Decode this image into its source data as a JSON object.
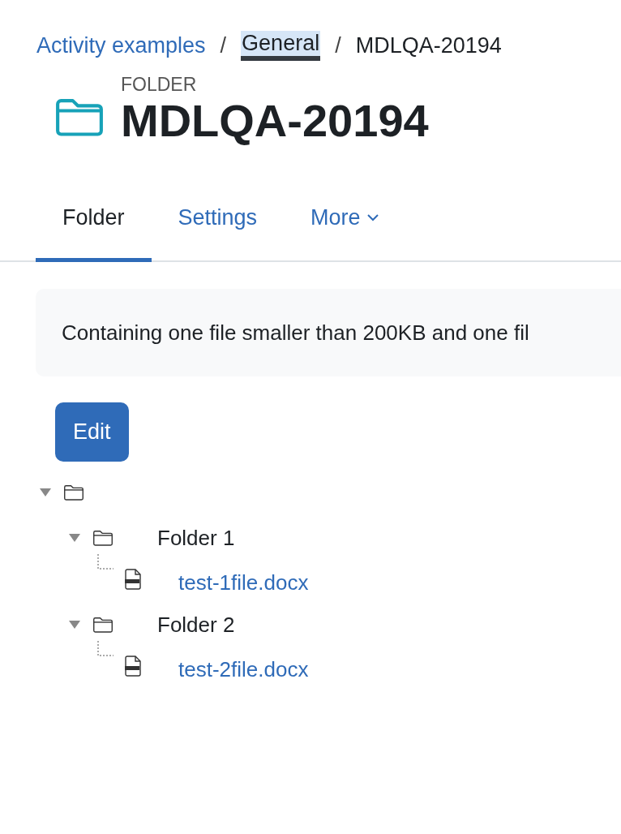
{
  "breadcrumb": [
    {
      "label": "Activity examples",
      "kind": "link",
      "highlighted": false
    },
    {
      "label": "General",
      "kind": "link",
      "highlighted": true
    },
    {
      "label": "MDLQA-20194",
      "kind": "current",
      "highlighted": false
    }
  ],
  "separator": "/",
  "header": {
    "type_label": "FOLDER",
    "title": "MDLQA-20194"
  },
  "tabs": [
    {
      "label": "Folder",
      "selected": true,
      "dropdown": false
    },
    {
      "label": "Settings",
      "selected": false,
      "dropdown": false
    },
    {
      "label": "More",
      "selected": false,
      "dropdown": true
    }
  ],
  "description": "Containing one file smaller than 200KB and one fil",
  "edit_button": "Edit",
  "tree": [
    {
      "kind": "folder",
      "expanded": true,
      "children": [
        {
          "kind": "folder",
          "name": "Folder 1",
          "expanded": true,
          "children": [
            {
              "kind": "file",
              "name": "test-1file.docx"
            }
          ]
        },
        {
          "kind": "folder",
          "name": "Folder 2",
          "expanded": true,
          "children": [
            {
              "kind": "file",
              "name": "test-2file.docx"
            }
          ]
        }
      ]
    }
  ]
}
